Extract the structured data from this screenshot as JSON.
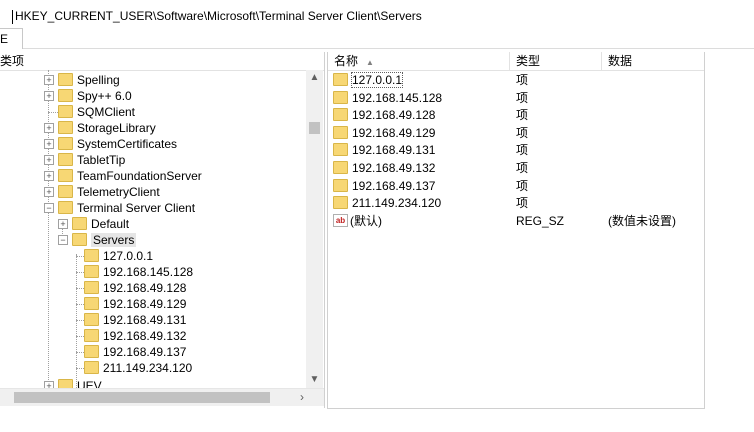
{
  "address": {
    "path": "HKEY_CURRENT_USER\\Software\\Microsoft\\Terminal Server Client\\Servers"
  },
  "tab": {
    "label": "E"
  },
  "tree": {
    "header": "类项",
    "nodes": [
      {
        "label": "Spelling"
      },
      {
        "label": "Spy++ 6.0"
      },
      {
        "label": "SQMClient"
      },
      {
        "label": "StorageLibrary"
      },
      {
        "label": "SystemCertificates"
      },
      {
        "label": "TabletTip"
      },
      {
        "label": "TeamFoundationServer"
      },
      {
        "label": "TelemetryClient"
      },
      {
        "label": "Terminal Server Client"
      },
      {
        "label": "Default"
      },
      {
        "label": "Servers"
      },
      {
        "label": "127.0.0.1"
      },
      {
        "label": "192.168.145.128"
      },
      {
        "label": "192.168.49.128"
      },
      {
        "label": "192.168.49.129"
      },
      {
        "label": "192.168.49.131"
      },
      {
        "label": "192.168.49.132"
      },
      {
        "label": "192.168.49.137"
      },
      {
        "label": "211.149.234.120"
      },
      {
        "label": "UEV"
      }
    ]
  },
  "list": {
    "columns": {
      "name": "名称",
      "type": "类型",
      "data": "数据"
    },
    "rows": [
      {
        "name": "127.0.0.1",
        "type": "项",
        "data": ""
      },
      {
        "name": "192.168.145.128",
        "type": "项",
        "data": ""
      },
      {
        "name": "192.168.49.128",
        "type": "项",
        "data": ""
      },
      {
        "name": "192.168.49.129",
        "type": "项",
        "data": ""
      },
      {
        "name": "192.168.49.131",
        "type": "项",
        "data": ""
      },
      {
        "name": "192.168.49.132",
        "type": "项",
        "data": ""
      },
      {
        "name": "192.168.49.137",
        "type": "项",
        "data": ""
      },
      {
        "name": "211.149.234.120",
        "type": "项",
        "data": ""
      },
      {
        "name": "(默认)",
        "type": "REG_SZ",
        "data": "(数值未设置)"
      }
    ]
  },
  "icons": {
    "folder": "folder-icon",
    "string_value": "ab-string-icon"
  },
  "colors": {
    "folder": "#f7d774",
    "selection": "#e5e5e5"
  }
}
